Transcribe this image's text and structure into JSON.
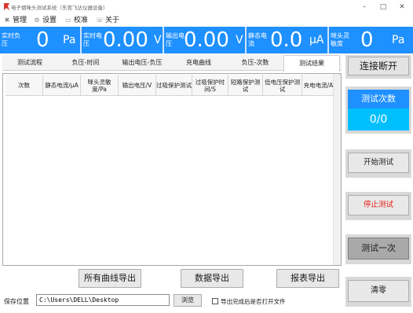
{
  "window": {
    "title": "电子烟咪头测试系统（东莞飞达仪器设备）",
    "minimize": "–",
    "maximize": "□",
    "close": "✕"
  },
  "menu": [
    {
      "label": "管理",
      "icon": "tools-icon"
    },
    {
      "label": "设置",
      "icon": "gear-icon"
    },
    {
      "label": "校准",
      "icon": "calibrate-icon"
    },
    {
      "label": "关于",
      "icon": "info-icon"
    }
  ],
  "status": [
    {
      "label": "实时负压",
      "value": "0",
      "unit": "Pa"
    },
    {
      "label": "实时电压",
      "value": "0.00",
      "unit": "V"
    },
    {
      "label": "输出电压",
      "value": "0.00",
      "unit": "V"
    },
    {
      "label": "静态电流",
      "value": "0.0",
      "unit": "μA"
    },
    {
      "label": "咪头灵敏度",
      "value": "0",
      "unit": "Pa"
    }
  ],
  "tabs": [
    "测试流程",
    "负压-时间",
    "输出电压-负压",
    "充电曲线",
    "负压-次数",
    "测试结果"
  ],
  "active_tab": "测试结果",
  "table": {
    "headers": [
      "次数",
      "静态电流/μA",
      "咪头灵敏度/Pa",
      "输出电压/V",
      "过吸保护测试",
      "过吸保护时间/S",
      "短路保护测试",
      "低电压保护测试",
      "充电电流/A"
    ]
  },
  "bottom": {
    "export_all_curves": "所有曲线导出",
    "export_data": "数据导出",
    "export_report": "报表导出",
    "save_location_label": "保存位置",
    "save_path": "C:\\Users\\DELL\\Desktop",
    "browse": "浏览",
    "open_after_export": "导出完成后是否打开文件"
  },
  "side": {
    "connect_toggle": "连接断开",
    "test_count_title": "测试次数",
    "test_count_value": "0/0",
    "start_test": "开始测试",
    "stop_test": "停止测试",
    "test_once": "测试一次",
    "clear": "清零"
  },
  "colors": {
    "status_bg": "#1e90ff",
    "count_value_bg": "#00bfff",
    "stop_text": "#e8201a"
  }
}
